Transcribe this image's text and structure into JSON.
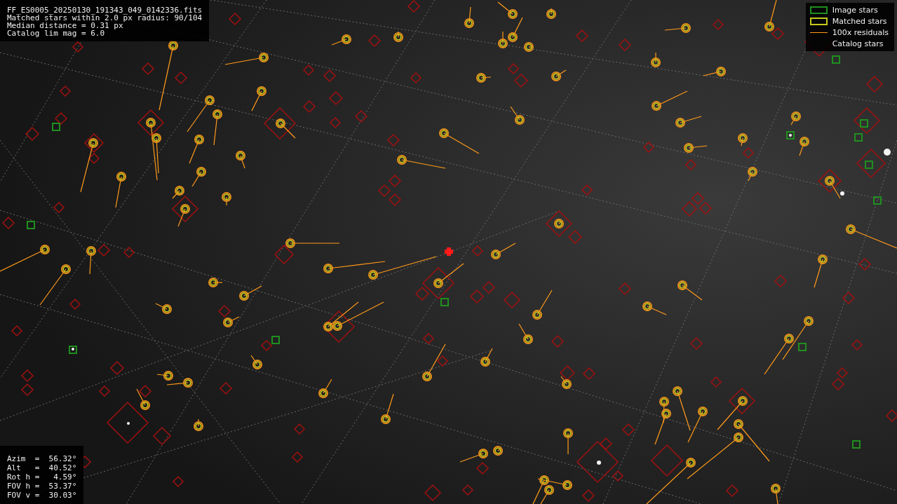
{
  "header": {
    "lines": [
      "FF_ES0005_20250130_191343_049_0142336.fits",
      "Matched stars within 2.0 px radius: 90/104",
      "Median distance = 0.31 px",
      "Catalog lim mag = 6.0"
    ]
  },
  "legend": [
    {
      "label": "Image stars",
      "kind": "box",
      "color": "#1f8f1f"
    },
    {
      "label": "Matched stars",
      "kind": "box",
      "color": "#c8c81e"
    },
    {
      "label": "100x residuals",
      "kind": "line",
      "color": "#ff9a1a"
    },
    {
      "label": "Catalog stars",
      "kind": "none"
    }
  ],
  "pointing": {
    "lines": [
      "Azim  =  56.32°",
      "Alt   =  40.52°",
      "Rot h =   4.59°",
      "FOV h =  53.37°",
      "FOV v =  30.03°"
    ]
  }
}
